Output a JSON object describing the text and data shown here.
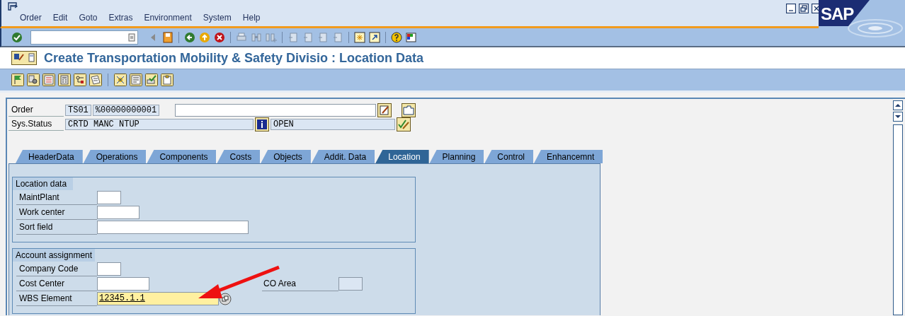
{
  "menu": [
    {
      "label": "Order"
    },
    {
      "label": "Edit"
    },
    {
      "label": "Goto"
    },
    {
      "label": "Extras"
    },
    {
      "label": "Environment"
    },
    {
      "label": "System"
    },
    {
      "label": "Help"
    }
  ],
  "logo": "SAP",
  "title": "Create Transportation Mobility & Safety Divisio : Location Data",
  "header": {
    "order_label": "Order",
    "order_type": "TS01",
    "order_number": "%00000000001",
    "status_label": "Sys.Status",
    "system_status": "CRTD MANC NTUP",
    "user_status": "OPEN"
  },
  "tabs": [
    {
      "label": "HeaderData",
      "selected": false
    },
    {
      "label": "Operations",
      "selected": false
    },
    {
      "label": "Components",
      "selected": false
    },
    {
      "label": "Costs",
      "selected": false
    },
    {
      "label": "Objects",
      "selected": false
    },
    {
      "label": "Addit. Data",
      "selected": false
    },
    {
      "label": "Location",
      "selected": true
    },
    {
      "label": "Planning",
      "selected": false
    },
    {
      "label": "Control",
      "selected": false
    },
    {
      "label": "Enhancemnt",
      "selected": false
    }
  ],
  "groups": [
    {
      "title": "Location data",
      "fields": [
        {
          "label": "MaintPlant",
          "focused": false
        },
        {
          "label": "Work center",
          "focused": false
        },
        {
          "label": "Sort field",
          "focused": false
        }
      ]
    },
    {
      "title": "Account assignment",
      "fields": [
        {
          "label": "Company Code",
          "focused": false
        },
        {
          "label": "Cost Center",
          "focused": false,
          "side": {
            "label": "CO Area",
            "disabled": true
          }
        },
        {
          "label": "WBS Element",
          "value": "12345.1.1",
          "focused": true
        }
      ]
    }
  ]
}
